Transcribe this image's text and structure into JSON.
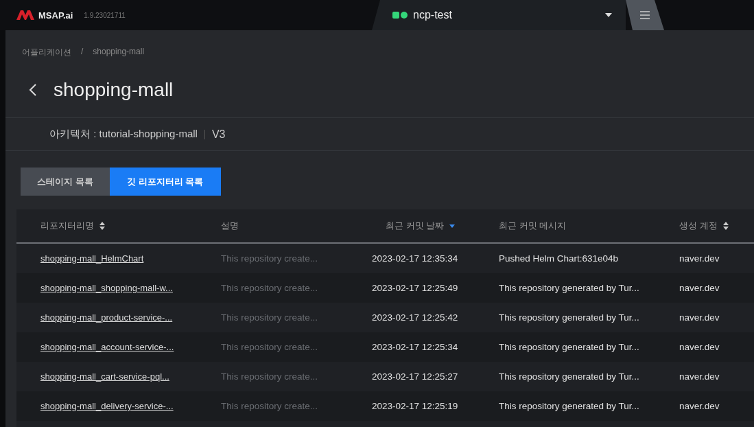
{
  "topbar": {
    "brand": "MSAP.ai",
    "version": "1.9.23021711",
    "workspace": "ncp-test"
  },
  "breadcrumb": [
    "어플리케이션",
    "/",
    "shopping-mall"
  ],
  "title": "shopping-mall",
  "architecture": {
    "label": "아키텍처 : tutorial-shopping-mall",
    "version": "V3"
  },
  "tabs": [
    {
      "label": "스테이지 목록",
      "selected": false
    },
    {
      "label": "깃 리포지터리 목록",
      "selected": true
    }
  ],
  "table": {
    "columns": [
      {
        "label": "리포지터리명",
        "kind": "sortable"
      },
      {
        "label": "설명",
        "kind": "plain"
      },
      {
        "label": "최근 커밋 날짜",
        "kind": "sorted"
      },
      {
        "label": "최근 커밋 메시지",
        "kind": "plain"
      },
      {
        "label": "생성 계정",
        "kind": "sortable"
      }
    ],
    "rows": [
      {
        "name": "shopping-mall_HelmChart",
        "description": "This repository create...",
        "date": "2023-02-17 12:35:34",
        "message": "Pushed Helm Chart:631e04b",
        "account": "naver.dev"
      },
      {
        "name": "shopping-mall_shopping-mall-w...",
        "description": "This repository create...",
        "date": "2023-02-17 12:25:49",
        "message": "This repository generated by Tur...",
        "account": "naver.dev"
      },
      {
        "name": "shopping-mall_product-service-...",
        "description": "This repository create...",
        "date": "2023-02-17 12:25:42",
        "message": "This repository generated by Tur...",
        "account": "naver.dev"
      },
      {
        "name": "shopping-mall_account-service-...",
        "description": "This repository create...",
        "date": "2023-02-17 12:25:34",
        "message": "This repository generated by Tur...",
        "account": "naver.dev"
      },
      {
        "name": "shopping-mall_cart-service-pql...",
        "description": "This repository create...",
        "date": "2023-02-17 12:25:27",
        "message": "This repository generated by Tur...",
        "account": "naver.dev"
      },
      {
        "name": "shopping-mall_delivery-service-...",
        "description": "This repository create...",
        "date": "2023-02-17 12:25:19",
        "message": "This repository generated by Tur...",
        "account": "naver.dev"
      }
    ]
  }
}
